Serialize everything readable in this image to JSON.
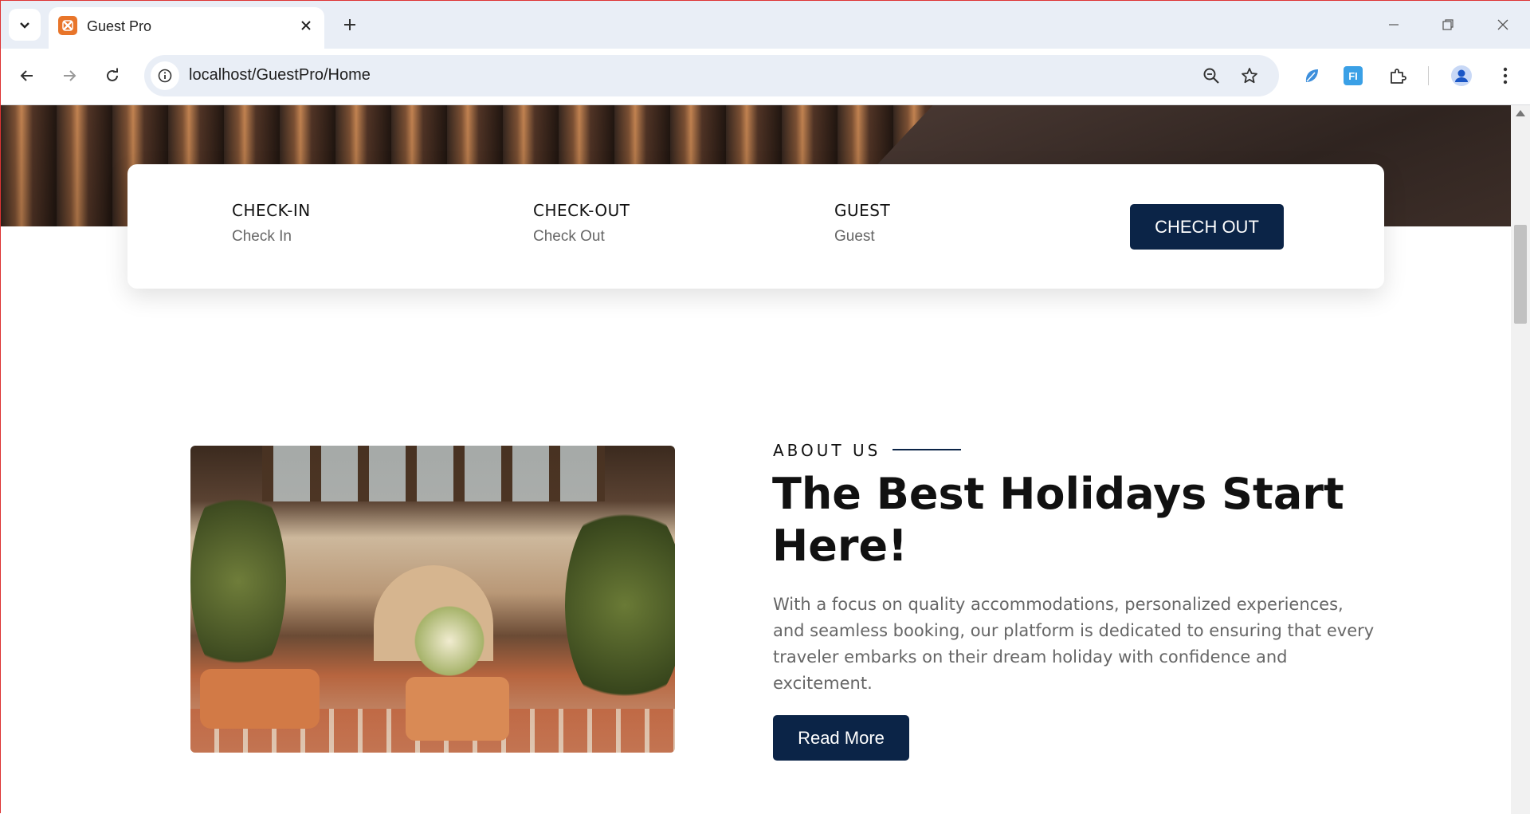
{
  "browser": {
    "tab_title": "Guest Pro",
    "url": "localhost/GuestPro/Home"
  },
  "booking": {
    "fields": [
      {
        "label": "CHECK-IN",
        "value": "Check In"
      },
      {
        "label": "CHECK-OUT",
        "value": "Check Out"
      },
      {
        "label": "GUEST",
        "value": "Guest"
      }
    ],
    "button_label": "CHECH OUT"
  },
  "about": {
    "eyebrow": "ABOUT US",
    "headline": "The Best Holidays Start Here!",
    "description": "With a focus on quality accommodations, personalized experiences, and seamless booking, our platform is dedicated to ensuring that every traveler embarks on their dream holiday with confidence and excitement.",
    "button_label": "Read More"
  },
  "colors": {
    "brand_navy": "#0b2447",
    "favicon_orange": "#e8752a"
  }
}
